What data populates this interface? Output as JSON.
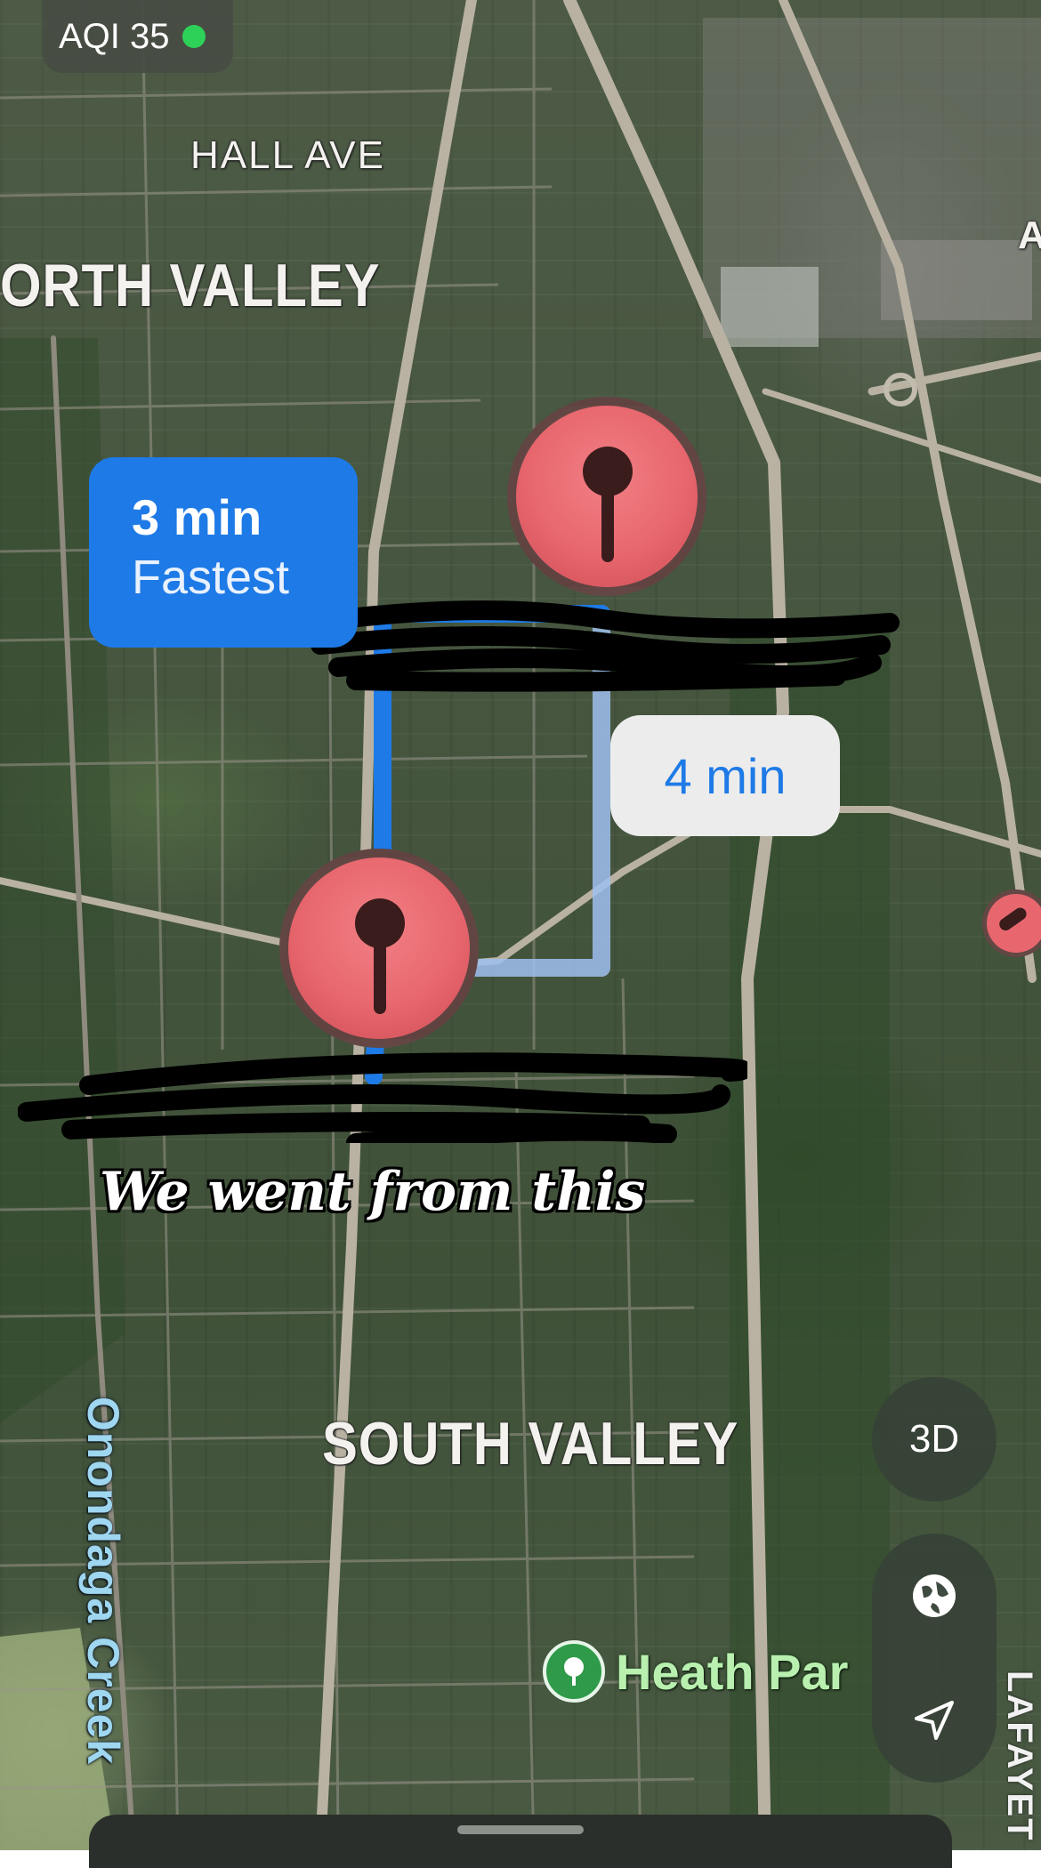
{
  "status": {
    "aqi_label": "AQI 35",
    "aqi_color": "#2ed158"
  },
  "map": {
    "neighborhoods": {
      "north": "ORTH VALLEY",
      "south": "SOUTH VALLEY"
    },
    "streets": {
      "hall_ave": "HALL AVE",
      "lafayette": "LAFAYET",
      "edge_label": "A"
    },
    "water": {
      "creek": "Onondaga Creek"
    },
    "poi": {
      "park": "Heath Par",
      "park_icon": "tree-icon"
    }
  },
  "routes": {
    "fastest": {
      "duration": "3 min",
      "tag": "Fastest",
      "color": "#1e7ae6"
    },
    "alternate": {
      "duration": "4 min",
      "color": "#7da6e0"
    }
  },
  "pins": {
    "start": "pin-icon",
    "end": "pin-icon",
    "color": "#e8676e"
  },
  "caption": "We went from this",
  "controls": {
    "three_d": "3D",
    "globe": "globe-icon",
    "location": "location-arrow-icon"
  }
}
